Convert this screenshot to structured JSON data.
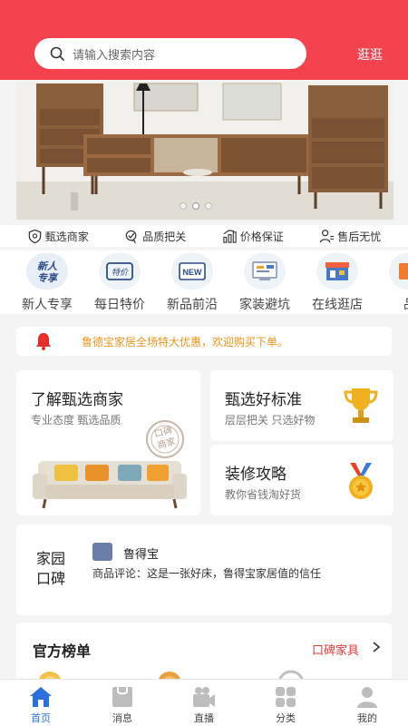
{
  "header": {
    "search_placeholder": "请输入搜索内容",
    "stroll_label": "逛逛",
    "bg_color": "#f5424f"
  },
  "banner": {
    "slide_count": 3,
    "active_index": 1
  },
  "guarantees": [
    {
      "label": "甄选商家",
      "icon": "shield-icon"
    },
    {
      "label": "品质把关",
      "icon": "quality-badge-icon"
    },
    {
      "label": "价格保证",
      "icon": "price-chart-icon"
    },
    {
      "label": "售后无忧",
      "icon": "service-person-icon"
    }
  ],
  "quick_entries": [
    {
      "label": "新人专享",
      "badge": "新人\n专享",
      "icon": "new-user-icon"
    },
    {
      "label": "每日特价",
      "badge": "特价",
      "icon": "daily-deal-icon"
    },
    {
      "label": "新品前沿",
      "badge": "NEW",
      "icon": "new-product-icon"
    },
    {
      "label": "家装避坑",
      "badge": "",
      "icon": "decor-guide-icon"
    },
    {
      "label": "在线逛店",
      "badge": "",
      "icon": "online-store-icon"
    },
    {
      "label": "品",
      "badge": "",
      "icon": "brand-icon"
    }
  ],
  "notice": {
    "text": "鲁德宝家居全场特大优惠，欢迎购买下单。"
  },
  "cards": {
    "merchant": {
      "title": "了解甄选商家",
      "subtitle": "专业态度 甄选品质",
      "stamp": "口碑\n商家"
    },
    "standard": {
      "title": "甄选好标准",
      "subtitle": "层层把关 只选好物"
    },
    "guide": {
      "title": "装修攻略",
      "subtitle": "教你省钱淘好货"
    }
  },
  "review": {
    "title": "家园口碑",
    "user": "鲁得宝",
    "text": "商品评论：这是一张好床，鲁得宝家居值的信任"
  },
  "ranking": {
    "title": "官方榜单",
    "more_label": "口碑家具"
  },
  "tabs": [
    {
      "label": "首页",
      "icon": "home-icon",
      "active": true
    },
    {
      "label": "消息",
      "icon": "message-icon",
      "active": false
    },
    {
      "label": "直播",
      "icon": "live-camera-icon",
      "active": false
    },
    {
      "label": "分类",
      "icon": "category-grid-icon",
      "active": false
    },
    {
      "label": "我的",
      "icon": "profile-icon",
      "active": false
    }
  ],
  "colors": {
    "accent": "#f5424f",
    "tab_active": "#2a6fdb",
    "notice_text": "#e8941a"
  }
}
